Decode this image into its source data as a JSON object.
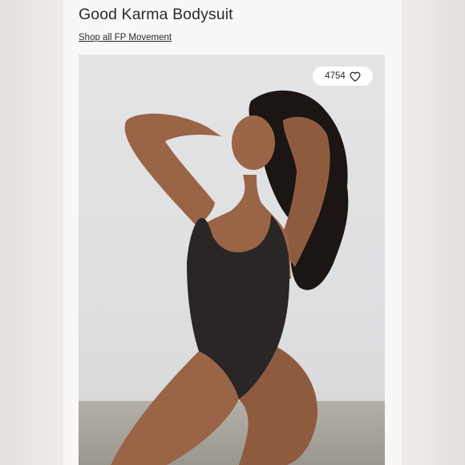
{
  "product": {
    "title": "Good Karma Bodysuit",
    "shop_link": "Shop all FP Movement"
  },
  "photo": {
    "likes": "4754",
    "like_icon": "heart-icon"
  },
  "colors": {
    "page_background": "#ebe8e4",
    "card_background": "#faf8f6",
    "text": "#2b2b2b",
    "bodysuit": "#2a2626",
    "skin": "#9a6446",
    "hair": "#1b1514"
  }
}
